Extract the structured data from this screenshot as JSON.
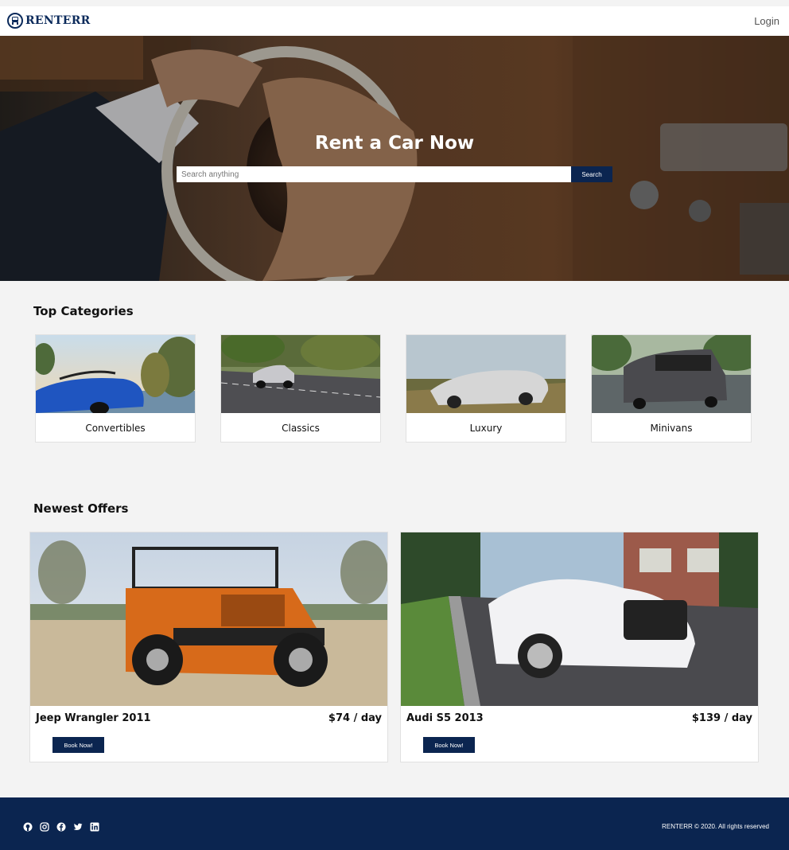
{
  "brand": {
    "name": "RENTERR",
    "icon": "car-logo-icon",
    "color": "#0b2a5b"
  },
  "nav": {
    "login_label": "Login"
  },
  "hero": {
    "title": "Rent a Car Now",
    "search_placeholder": "Search anything",
    "search_button": "Search"
  },
  "categories": {
    "title": "Top Categories",
    "items": [
      {
        "label": "Convertibles"
      },
      {
        "label": "Classics"
      },
      {
        "label": "Luxury"
      },
      {
        "label": "Minivans"
      }
    ]
  },
  "offers": {
    "title": "Newest Offers",
    "items": [
      {
        "name": "Jeep Wrangler 2011",
        "price": "$74 / day",
        "button": "Book Now!"
      },
      {
        "name": "Audi S5 2013",
        "price": "$139 / day",
        "button": "Book Now!"
      }
    ]
  },
  "footer": {
    "social_icons": [
      "github-icon",
      "instagram-icon",
      "facebook-icon",
      "twitter-icon",
      "linkedin-icon"
    ],
    "copyright": "RENTERR © 2020. All rights reserved"
  },
  "colors": {
    "primary": "#0b2550",
    "background": "#f3f3f3"
  }
}
